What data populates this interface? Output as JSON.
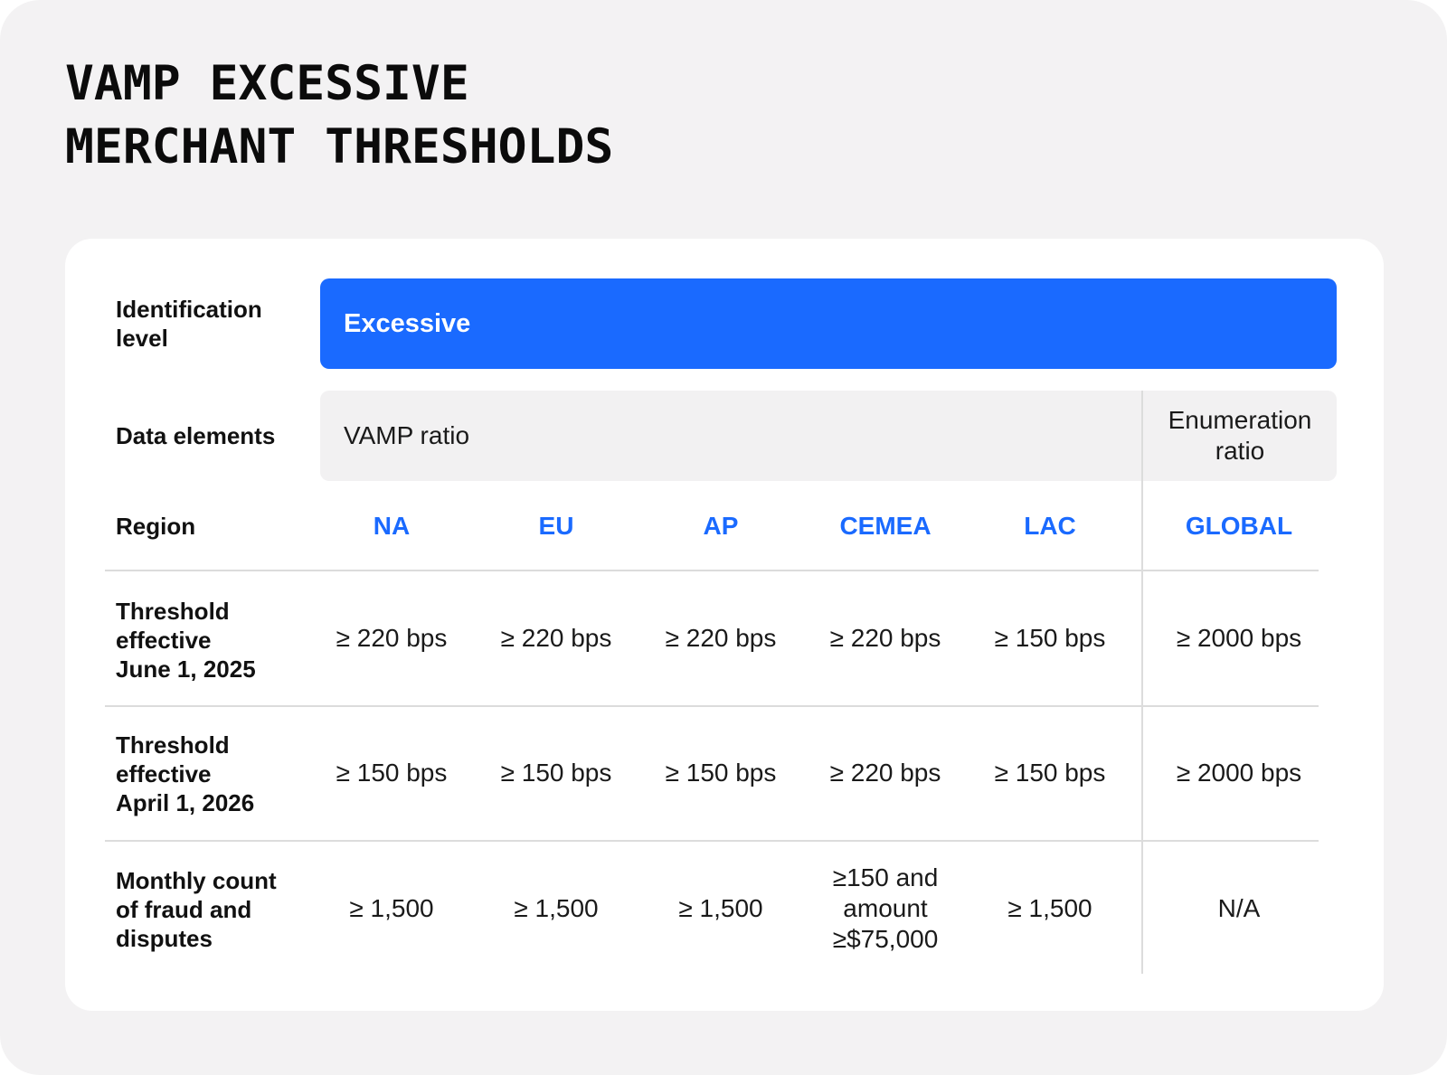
{
  "title": {
    "line1": "VAMP EXCESSIVE",
    "line2": "MERCHANT THRESHOLDS"
  },
  "colors": {
    "accent": "#1a6aff",
    "page_bg": "#f3f2f3",
    "card_bg": "#ffffff",
    "data_bar_bg": "#f2f1f2"
  },
  "table": {
    "identification": {
      "label": "Identification level",
      "value": "Excessive"
    },
    "data_elements": {
      "label": "Data elements",
      "vamp": "VAMP ratio",
      "enumeration": "Enumeration ratio"
    },
    "region": {
      "label": "Region",
      "values": [
        "NA",
        "EU",
        "AP",
        "CEMEA",
        "LAC",
        "GLOBAL"
      ]
    },
    "rows": [
      {
        "label_lines": [
          "Threshold",
          "effective",
          "June 1, 2025"
        ],
        "values": [
          "≥ 220 bps",
          "≥ 220 bps",
          "≥ 220 bps",
          "≥ 220 bps",
          "≥ 150 bps",
          "≥ 2000 bps"
        ]
      },
      {
        "label_lines": [
          "Threshold",
          "effective",
          "April 1, 2026"
        ],
        "values": [
          "≥ 150 bps",
          "≥ 150 bps",
          "≥ 150 bps",
          "≥ 220 bps",
          "≥ 150 bps",
          "≥ 2000 bps"
        ]
      },
      {
        "label_lines": [
          "Monthly count",
          "of fraud and",
          "disputes"
        ],
        "values": [
          "≥ 1,500",
          "≥ 1,500",
          "≥ 1,500",
          "≥150 and amount ≥$75,000",
          "≥ 1,500",
          "N/A"
        ]
      }
    ]
  }
}
